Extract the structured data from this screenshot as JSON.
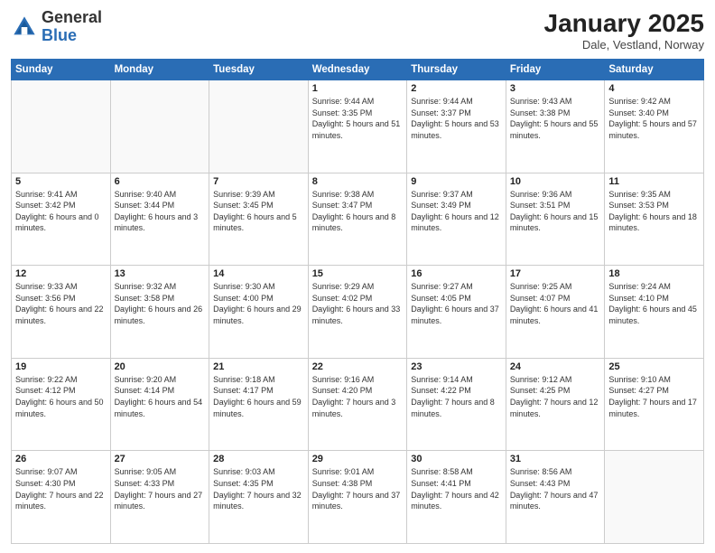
{
  "header": {
    "logo_general": "General",
    "logo_blue": "Blue",
    "month_title": "January 2025",
    "location": "Dale, Vestland, Norway"
  },
  "days_of_week": [
    "Sunday",
    "Monday",
    "Tuesday",
    "Wednesday",
    "Thursday",
    "Friday",
    "Saturday"
  ],
  "weeks": [
    [
      {
        "day": "",
        "info": ""
      },
      {
        "day": "",
        "info": ""
      },
      {
        "day": "",
        "info": ""
      },
      {
        "day": "1",
        "info": "Sunrise: 9:44 AM\nSunset: 3:35 PM\nDaylight: 5 hours\nand 51 minutes."
      },
      {
        "day": "2",
        "info": "Sunrise: 9:44 AM\nSunset: 3:37 PM\nDaylight: 5 hours\nand 53 minutes."
      },
      {
        "day": "3",
        "info": "Sunrise: 9:43 AM\nSunset: 3:38 PM\nDaylight: 5 hours\nand 55 minutes."
      },
      {
        "day": "4",
        "info": "Sunrise: 9:42 AM\nSunset: 3:40 PM\nDaylight: 5 hours\nand 57 minutes."
      }
    ],
    [
      {
        "day": "5",
        "info": "Sunrise: 9:41 AM\nSunset: 3:42 PM\nDaylight: 6 hours\nand 0 minutes."
      },
      {
        "day": "6",
        "info": "Sunrise: 9:40 AM\nSunset: 3:44 PM\nDaylight: 6 hours\nand 3 minutes."
      },
      {
        "day": "7",
        "info": "Sunrise: 9:39 AM\nSunset: 3:45 PM\nDaylight: 6 hours\nand 5 minutes."
      },
      {
        "day": "8",
        "info": "Sunrise: 9:38 AM\nSunset: 3:47 PM\nDaylight: 6 hours\nand 8 minutes."
      },
      {
        "day": "9",
        "info": "Sunrise: 9:37 AM\nSunset: 3:49 PM\nDaylight: 6 hours\nand 12 minutes."
      },
      {
        "day": "10",
        "info": "Sunrise: 9:36 AM\nSunset: 3:51 PM\nDaylight: 6 hours\nand 15 minutes."
      },
      {
        "day": "11",
        "info": "Sunrise: 9:35 AM\nSunset: 3:53 PM\nDaylight: 6 hours\nand 18 minutes."
      }
    ],
    [
      {
        "day": "12",
        "info": "Sunrise: 9:33 AM\nSunset: 3:56 PM\nDaylight: 6 hours\nand 22 minutes."
      },
      {
        "day": "13",
        "info": "Sunrise: 9:32 AM\nSunset: 3:58 PM\nDaylight: 6 hours\nand 26 minutes."
      },
      {
        "day": "14",
        "info": "Sunrise: 9:30 AM\nSunset: 4:00 PM\nDaylight: 6 hours\nand 29 minutes."
      },
      {
        "day": "15",
        "info": "Sunrise: 9:29 AM\nSunset: 4:02 PM\nDaylight: 6 hours\nand 33 minutes."
      },
      {
        "day": "16",
        "info": "Sunrise: 9:27 AM\nSunset: 4:05 PM\nDaylight: 6 hours\nand 37 minutes."
      },
      {
        "day": "17",
        "info": "Sunrise: 9:25 AM\nSunset: 4:07 PM\nDaylight: 6 hours\nand 41 minutes."
      },
      {
        "day": "18",
        "info": "Sunrise: 9:24 AM\nSunset: 4:10 PM\nDaylight: 6 hours\nand 45 minutes."
      }
    ],
    [
      {
        "day": "19",
        "info": "Sunrise: 9:22 AM\nSunset: 4:12 PM\nDaylight: 6 hours\nand 50 minutes."
      },
      {
        "day": "20",
        "info": "Sunrise: 9:20 AM\nSunset: 4:14 PM\nDaylight: 6 hours\nand 54 minutes."
      },
      {
        "day": "21",
        "info": "Sunrise: 9:18 AM\nSunset: 4:17 PM\nDaylight: 6 hours\nand 59 minutes."
      },
      {
        "day": "22",
        "info": "Sunrise: 9:16 AM\nSunset: 4:20 PM\nDaylight: 7 hours\nand 3 minutes."
      },
      {
        "day": "23",
        "info": "Sunrise: 9:14 AM\nSunset: 4:22 PM\nDaylight: 7 hours\nand 8 minutes."
      },
      {
        "day": "24",
        "info": "Sunrise: 9:12 AM\nSunset: 4:25 PM\nDaylight: 7 hours\nand 12 minutes."
      },
      {
        "day": "25",
        "info": "Sunrise: 9:10 AM\nSunset: 4:27 PM\nDaylight: 7 hours\nand 17 minutes."
      }
    ],
    [
      {
        "day": "26",
        "info": "Sunrise: 9:07 AM\nSunset: 4:30 PM\nDaylight: 7 hours\nand 22 minutes."
      },
      {
        "day": "27",
        "info": "Sunrise: 9:05 AM\nSunset: 4:33 PM\nDaylight: 7 hours\nand 27 minutes."
      },
      {
        "day": "28",
        "info": "Sunrise: 9:03 AM\nSunset: 4:35 PM\nDaylight: 7 hours\nand 32 minutes."
      },
      {
        "day": "29",
        "info": "Sunrise: 9:01 AM\nSunset: 4:38 PM\nDaylight: 7 hours\nand 37 minutes."
      },
      {
        "day": "30",
        "info": "Sunrise: 8:58 AM\nSunset: 4:41 PM\nDaylight: 7 hours\nand 42 minutes."
      },
      {
        "day": "31",
        "info": "Sunrise: 8:56 AM\nSunset: 4:43 PM\nDaylight: 7 hours\nand 47 minutes."
      },
      {
        "day": "",
        "info": ""
      }
    ]
  ]
}
